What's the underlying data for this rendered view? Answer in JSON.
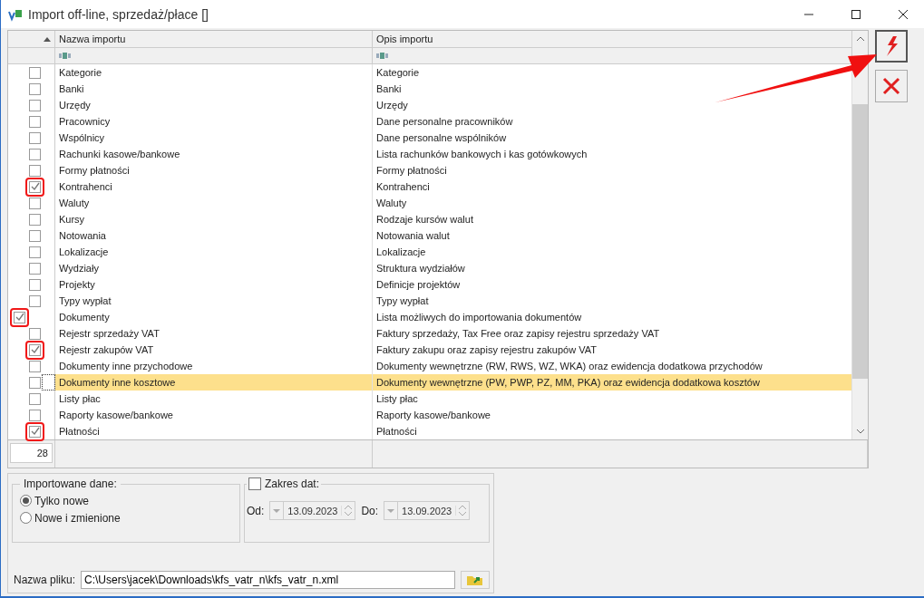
{
  "window": {
    "title": "Import off-line, sprzedaż/płace []"
  },
  "grid": {
    "columns": [
      "Nazwa importu",
      "Opis importu"
    ],
    "rows": [
      {
        "kind": "item",
        "name": "Kategorie",
        "description": "Kategorie",
        "checked": false,
        "selected": false,
        "annotated": false
      },
      {
        "kind": "item",
        "name": "Banki",
        "description": "Banki",
        "checked": false,
        "selected": false,
        "annotated": false
      },
      {
        "kind": "item",
        "name": "Urzędy",
        "description": "Urzędy",
        "checked": false,
        "selected": false,
        "annotated": false
      },
      {
        "kind": "item",
        "name": "Pracownicy",
        "description": "Dane personalne pracowników",
        "checked": false,
        "selected": false,
        "annotated": false
      },
      {
        "kind": "item",
        "name": "Wspólnicy",
        "description": "Dane personalne wspólników",
        "checked": false,
        "selected": false,
        "annotated": false
      },
      {
        "kind": "item",
        "name": "Rachunki kasowe/bankowe",
        "description": "Lista rachunków bankowych i kas gotówkowych",
        "checked": false,
        "selected": false,
        "annotated": false
      },
      {
        "kind": "item",
        "name": "Formy płatności",
        "description": "Formy płatności",
        "checked": false,
        "selected": false,
        "annotated": false
      },
      {
        "kind": "item",
        "name": "Kontrahenci",
        "description": "Kontrahenci",
        "checked": true,
        "selected": false,
        "annotated": true
      },
      {
        "kind": "item",
        "name": "Waluty",
        "description": "Waluty",
        "checked": false,
        "selected": false,
        "annotated": false
      },
      {
        "kind": "item",
        "name": "Kursy",
        "description": "Rodzaje kursów walut",
        "checked": false,
        "selected": false,
        "annotated": false
      },
      {
        "kind": "item",
        "name": "Notowania",
        "description": "Notowania walut",
        "checked": false,
        "selected": false,
        "annotated": false
      },
      {
        "kind": "item",
        "name": "Lokalizacje",
        "description": "Lokalizacje",
        "checked": false,
        "selected": false,
        "annotated": false
      },
      {
        "kind": "item",
        "name": "Wydziały",
        "description": "Struktura wydziałów",
        "checked": false,
        "selected": false,
        "annotated": false
      },
      {
        "kind": "item",
        "name": "Projekty",
        "description": "Definicje projektów",
        "checked": false,
        "selected": false,
        "annotated": false
      },
      {
        "kind": "item",
        "name": "Typy wypłat",
        "description": "Typy wypłat",
        "checked": false,
        "selected": false,
        "annotated": false
      },
      {
        "kind": "group",
        "name": "Dokumenty",
        "description": "Lista możliwych do importowania dokumentów",
        "checked": true,
        "selected": false,
        "annotated": true,
        "children": [
          {
            "name": "Rejestr sprzedaży VAT",
            "description": "Faktury sprzedaży, Tax Free oraz zapisy rejestru sprzedaży VAT",
            "checked": false,
            "selected": false,
            "annotated": false
          },
          {
            "name": "Rejestr zakupów VAT",
            "description": "Faktury zakupu oraz zapisy rejestru zakupów VAT",
            "checked": true,
            "selected": false,
            "annotated": true
          },
          {
            "name": "Dokumenty inne przychodowe",
            "description": "Dokumenty wewnętrzne (RW, RWS, WZ, WKA) oraz ewidencja dodatkowa przychodów",
            "checked": false,
            "selected": false,
            "annotated": false
          },
          {
            "name": "Dokumenty inne kosztowe",
            "description": "Dokumenty wewnętrzne (PW, PWP, PZ, MM, PKA) oraz ewidencja dodatkowa kosztów",
            "checked": false,
            "selected": true,
            "annotated": false
          },
          {
            "name": "Listy płac",
            "description": "Listy płac",
            "checked": false,
            "selected": false,
            "annotated": false
          },
          {
            "name": "Raporty kasowe/bankowe",
            "description": "Raporty kasowe/bankowe",
            "checked": false,
            "selected": false,
            "annotated": false
          },
          {
            "name": "Płatności",
            "description": "Płatności",
            "checked": true,
            "selected": false,
            "annotated": true
          }
        ]
      }
    ],
    "count": "28"
  },
  "imported_data": {
    "label": "Importowane dane:",
    "options": [
      {
        "label": "Tylko nowe",
        "selected": true
      },
      {
        "label": "Nowe i zmienione",
        "selected": false
      }
    ]
  },
  "date_range": {
    "label": "Zakres dat:",
    "checked": false,
    "from_label": "Od:",
    "from": "13.09.2023",
    "to_label": "Do:",
    "to": "13.09.2023"
  },
  "file": {
    "label": "Nazwa pliku:",
    "value": "C:\\Users\\jacek\\Downloads\\kfs_vatr_n\\kfs_vatr_n.xml"
  }
}
